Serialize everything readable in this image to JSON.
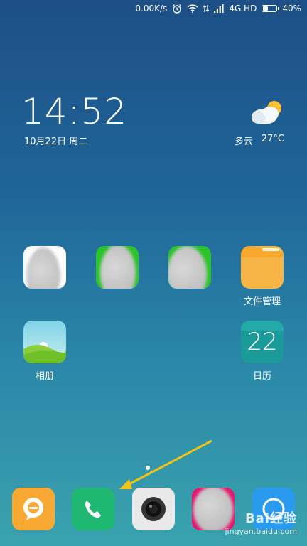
{
  "status_bar": {
    "speed": "0.00K/s",
    "network": "4G HD",
    "battery_text": "40%",
    "battery_level": 0.4
  },
  "clock": {
    "time": "14:52",
    "date": "10月22日 周二"
  },
  "weather": {
    "condition": "多云",
    "temperature": "27°C",
    "icon": "partly-cloudy-icon"
  },
  "apps": {
    "files_label": "文件管理",
    "gallery_label": "相册",
    "calendar_label": "日历",
    "calendar_day": "22"
  },
  "dock": {
    "items": [
      "messages-icon",
      "phone-icon",
      "camera-icon",
      "blurred-app-icon",
      "browser-icon"
    ]
  },
  "watermark": {
    "brand": "Bai经验",
    "url": "jingyan.baidu.com"
  },
  "colors": {
    "files": "#f8b547",
    "calendar": "#1a9b9a",
    "phone": "#1eb873",
    "messages": "#f8a934",
    "browser": "#2a9aef",
    "arrow": "#f0c419"
  }
}
